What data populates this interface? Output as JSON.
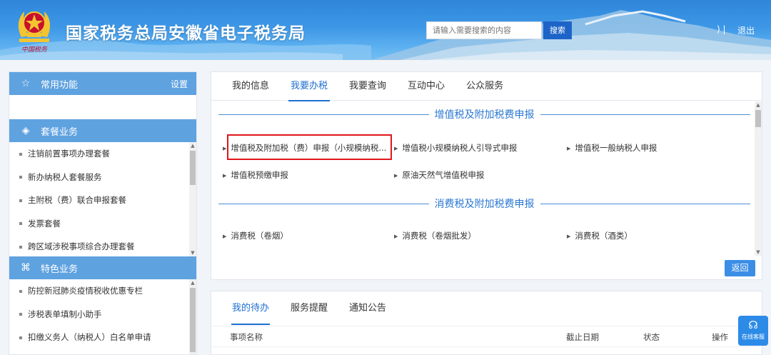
{
  "header": {
    "emblem_text": "中国税务",
    "title": "国家税务总局安徽省电子税务局",
    "search_placeholder": "请输入需要搜索的内容",
    "search_button": "搜索",
    "user_separator": ")  |",
    "logout": "退出"
  },
  "sidebar": {
    "common": {
      "title": "常用功能",
      "settings": "设置"
    },
    "package": {
      "title": "套餐业务",
      "items": [
        {
          "label": "注销前置事项办理套餐"
        },
        {
          "label": "新办纳税人套餐服务"
        },
        {
          "label": "主附税（费）联合申报套餐"
        },
        {
          "label": "发票套餐"
        },
        {
          "label": "跨区域涉税事项综合办理套餐"
        }
      ]
    },
    "special": {
      "title": "特色业务",
      "items": [
        {
          "label": "防控新冠肺炎疫情税收优惠专栏"
        },
        {
          "label": "涉税表单填制小助手"
        },
        {
          "label": "扣缴义务人（纳税人）白名单申请"
        }
      ]
    }
  },
  "main": {
    "tabs": [
      {
        "label": "我的信息"
      },
      {
        "label": "我要办税"
      },
      {
        "label": "我要查询"
      },
      {
        "label": "互动中心"
      },
      {
        "label": "公众服务"
      }
    ],
    "active_tab": "我要办税",
    "sections": [
      {
        "title": "增值税及附加税费申报",
        "items": [
          {
            "label": "增值税及附加税（费）申报（小规模纳税..."
          },
          {
            "label": "增值税小规模纳税人引导式申报"
          },
          {
            "label": "增值税一般纳税人申报"
          },
          {
            "label": "增值税预缴申报"
          },
          {
            "label": "原油天然气增值税申报"
          }
        ]
      },
      {
        "title": "消费税及附加税费申报",
        "items": [
          {
            "label": "消费税（卷烟）"
          },
          {
            "label": "消费税（卷烟批发）"
          },
          {
            "label": "消费税（酒类）"
          }
        ]
      }
    ],
    "highlighted_item": "增值税及附加税（费）申报（小规模纳税...",
    "back_button": "返回"
  },
  "todo": {
    "tabs": [
      {
        "label": "我的待办"
      },
      {
        "label": "服务提醒"
      },
      {
        "label": "通知公告"
      }
    ],
    "columns": {
      "name": "事项名称",
      "deadline": "截止日期",
      "status": "状态",
      "action": "操作"
    }
  },
  "customer_service": {
    "label": "在线客服"
  },
  "colors": {
    "accent": "#1e6fd0",
    "highlight_box": "#e0161b",
    "sidebar_head": "#5fa2e0",
    "header_blue": "#2f86d9"
  }
}
